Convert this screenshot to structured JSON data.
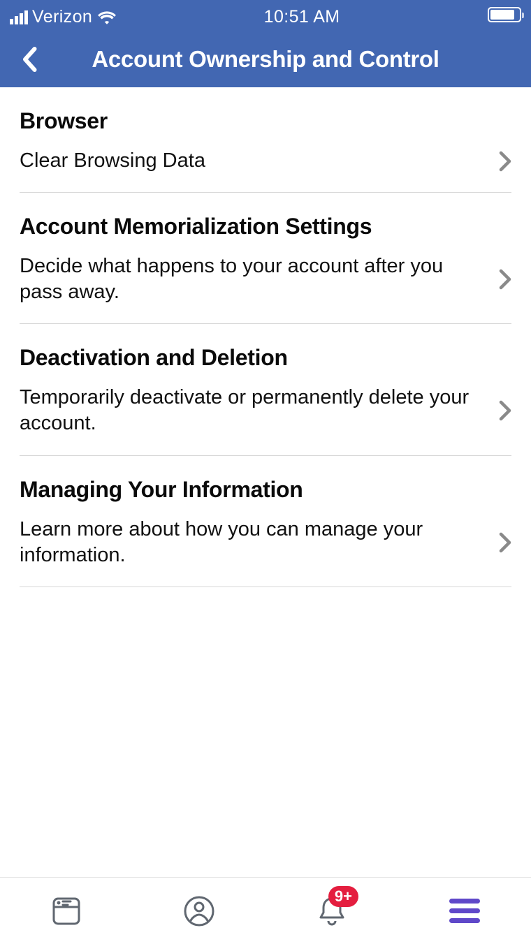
{
  "status": {
    "carrier": "Verizon",
    "time": "10:51 AM"
  },
  "header": {
    "title": "Account Ownership and Control"
  },
  "sections": [
    {
      "title": "Browser",
      "row_text": "Clear Browsing Data"
    },
    {
      "title": "Account Memorialization Settings",
      "row_text": "Decide what happens to your account after you pass away."
    },
    {
      "title": "Deactivation and Deletion",
      "row_text": "Temporarily deactivate or permanently delete your account."
    },
    {
      "title": "Managing Your Information",
      "row_text": "Learn more about how you can manage your information."
    }
  ],
  "tabs": {
    "notifications_badge": "9+"
  }
}
